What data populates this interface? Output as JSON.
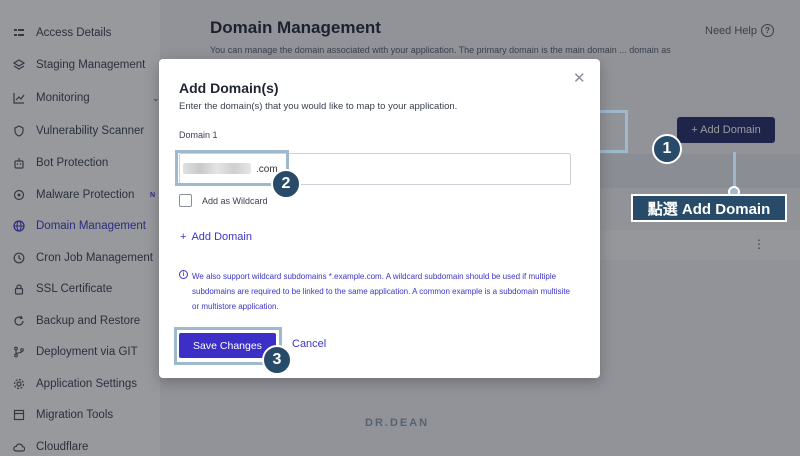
{
  "sidebar": {
    "items": [
      {
        "label": "Access Details",
        "icon": "list-icon"
      },
      {
        "label": "Staging Management",
        "icon": "layers-icon"
      },
      {
        "label": "Monitoring",
        "icon": "chart-line-icon"
      },
      {
        "label": "Vulnerability Scanner",
        "icon": "shield-icon"
      },
      {
        "label": "Bot Protection",
        "icon": "robot-icon"
      },
      {
        "label": "Malware Protection",
        "icon": "bug-icon",
        "badge": "N"
      },
      {
        "label": "Domain Management",
        "icon": "globe-icon"
      },
      {
        "label": "Cron Job Management",
        "icon": "history-icon"
      },
      {
        "label": "SSL Certificate",
        "icon": "lock-icon"
      },
      {
        "label": "Backup and Restore",
        "icon": "refresh-icon"
      },
      {
        "label": "Deployment via GIT",
        "icon": "git-branch-icon"
      },
      {
        "label": "Application Settings",
        "icon": "gear-icon"
      },
      {
        "label": "Migration Tools",
        "icon": "migration-icon"
      },
      {
        "label": "Cloudflare",
        "icon": "cloud-icon"
      }
    ]
  },
  "main": {
    "title": "Domain Management",
    "description": "You can manage the domain associated with your application. The primary domain is the main domain ... domain as primary will ... ards for the domain(s)",
    "help": "Need Help",
    "add_button": "+ Add Domain",
    "logo": "DR.DEAN"
  },
  "modal": {
    "title": "Add Domain(s)",
    "subtitle": "Enter the domain(s) that you would like to map to your application.",
    "field_label": "Domain 1",
    "domain_value": ".com",
    "wildcard_label": "Add as Wildcard",
    "add_link": "Add Domain",
    "note": "We also support wildcard subdomains *.example.com. A wildcard subdomain should be used if multiple subdomains are required to be linked to the same application. A common example is a subdomain multisite or multistore application.",
    "save": "Save Changes",
    "cancel": "Cancel"
  },
  "annotations": {
    "step1": "1",
    "step2": "2",
    "step3": "3",
    "callout": "點選 Add Domain"
  },
  "colors": {
    "accent": "#3b35c9",
    "primary_button": "#3b2fc7",
    "dark_button": "#262a68",
    "annotation": "#284b69",
    "highlight": "#9fb9cc"
  }
}
